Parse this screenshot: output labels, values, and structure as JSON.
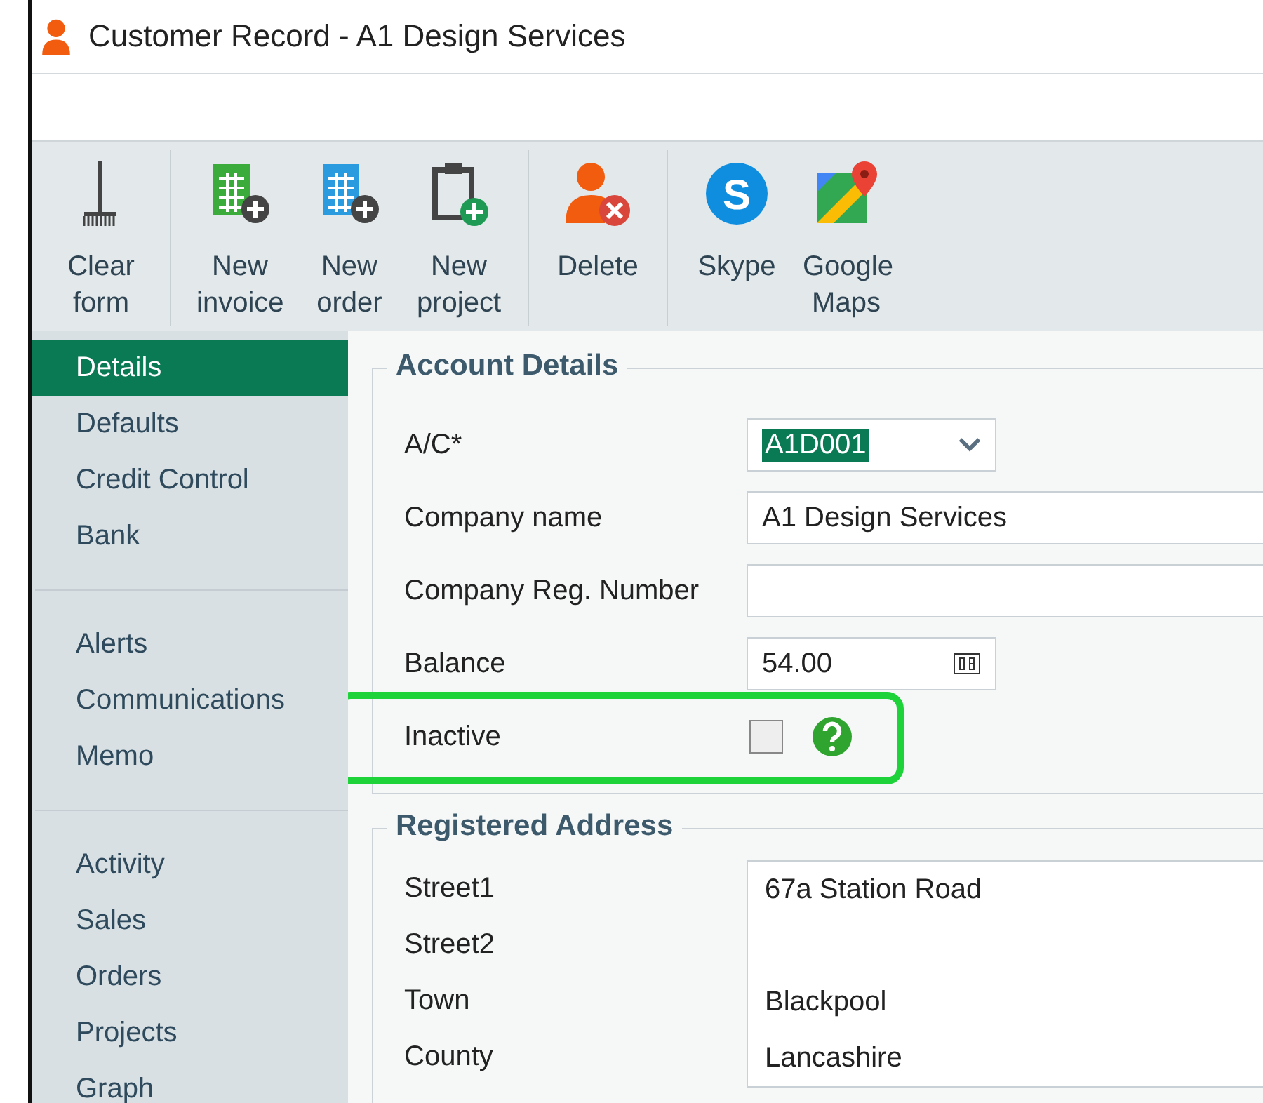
{
  "window": {
    "title": "Customer Record - A1 Design Services"
  },
  "toolbar": {
    "groups": [
      [
        {
          "kind": "clear",
          "label": "Clear form"
        }
      ],
      [
        {
          "kind": "invoice",
          "label": "New invoice"
        },
        {
          "kind": "order",
          "label": "New order"
        },
        {
          "kind": "project",
          "label": "New project"
        }
      ],
      [
        {
          "kind": "delete",
          "label": "Delete"
        }
      ],
      [
        {
          "kind": "skype",
          "label": "Skype",
          "glyph": "S"
        },
        {
          "kind": "maps",
          "label": "Google Maps"
        }
      ]
    ]
  },
  "sidebar": {
    "groups": [
      [
        {
          "label": "Details",
          "selected": true
        },
        {
          "label": "Defaults",
          "selected": false
        },
        {
          "label": "Credit Control",
          "selected": false
        },
        {
          "label": "Bank",
          "selected": false
        }
      ],
      [
        {
          "label": "Alerts",
          "selected": false
        },
        {
          "label": "Communications",
          "selected": false
        },
        {
          "label": "Memo",
          "selected": false
        }
      ],
      [
        {
          "label": "Activity",
          "selected": false
        },
        {
          "label": "Sales",
          "selected": false
        },
        {
          "label": "Orders",
          "selected": false
        },
        {
          "label": "Projects",
          "selected": false
        },
        {
          "label": "Graph",
          "selected": false
        }
      ]
    ]
  },
  "account_details": {
    "title": "Account Details",
    "fields": [
      {
        "kind": "combo",
        "label": "A/C*",
        "value": "A1D001"
      },
      {
        "kind": "text",
        "label": "Company name",
        "value": "A1 Design Services"
      },
      {
        "kind": "text",
        "label": "Company Reg. Number"
      },
      {
        "kind": "balance",
        "label": "Balance",
        "value": "54.00"
      },
      {
        "kind": "checkbox",
        "label": "Inactive",
        "checked": false,
        "highlighted": true
      }
    ]
  },
  "registered_address": {
    "title": "Registered Address",
    "rows": [
      {
        "label": "Street1",
        "value": "67a Station Road"
      },
      {
        "label": "Street2"
      },
      {
        "label": "Town",
        "value": "Blackpool"
      },
      {
        "label": "County",
        "value": "Lancashire"
      }
    ]
  }
}
